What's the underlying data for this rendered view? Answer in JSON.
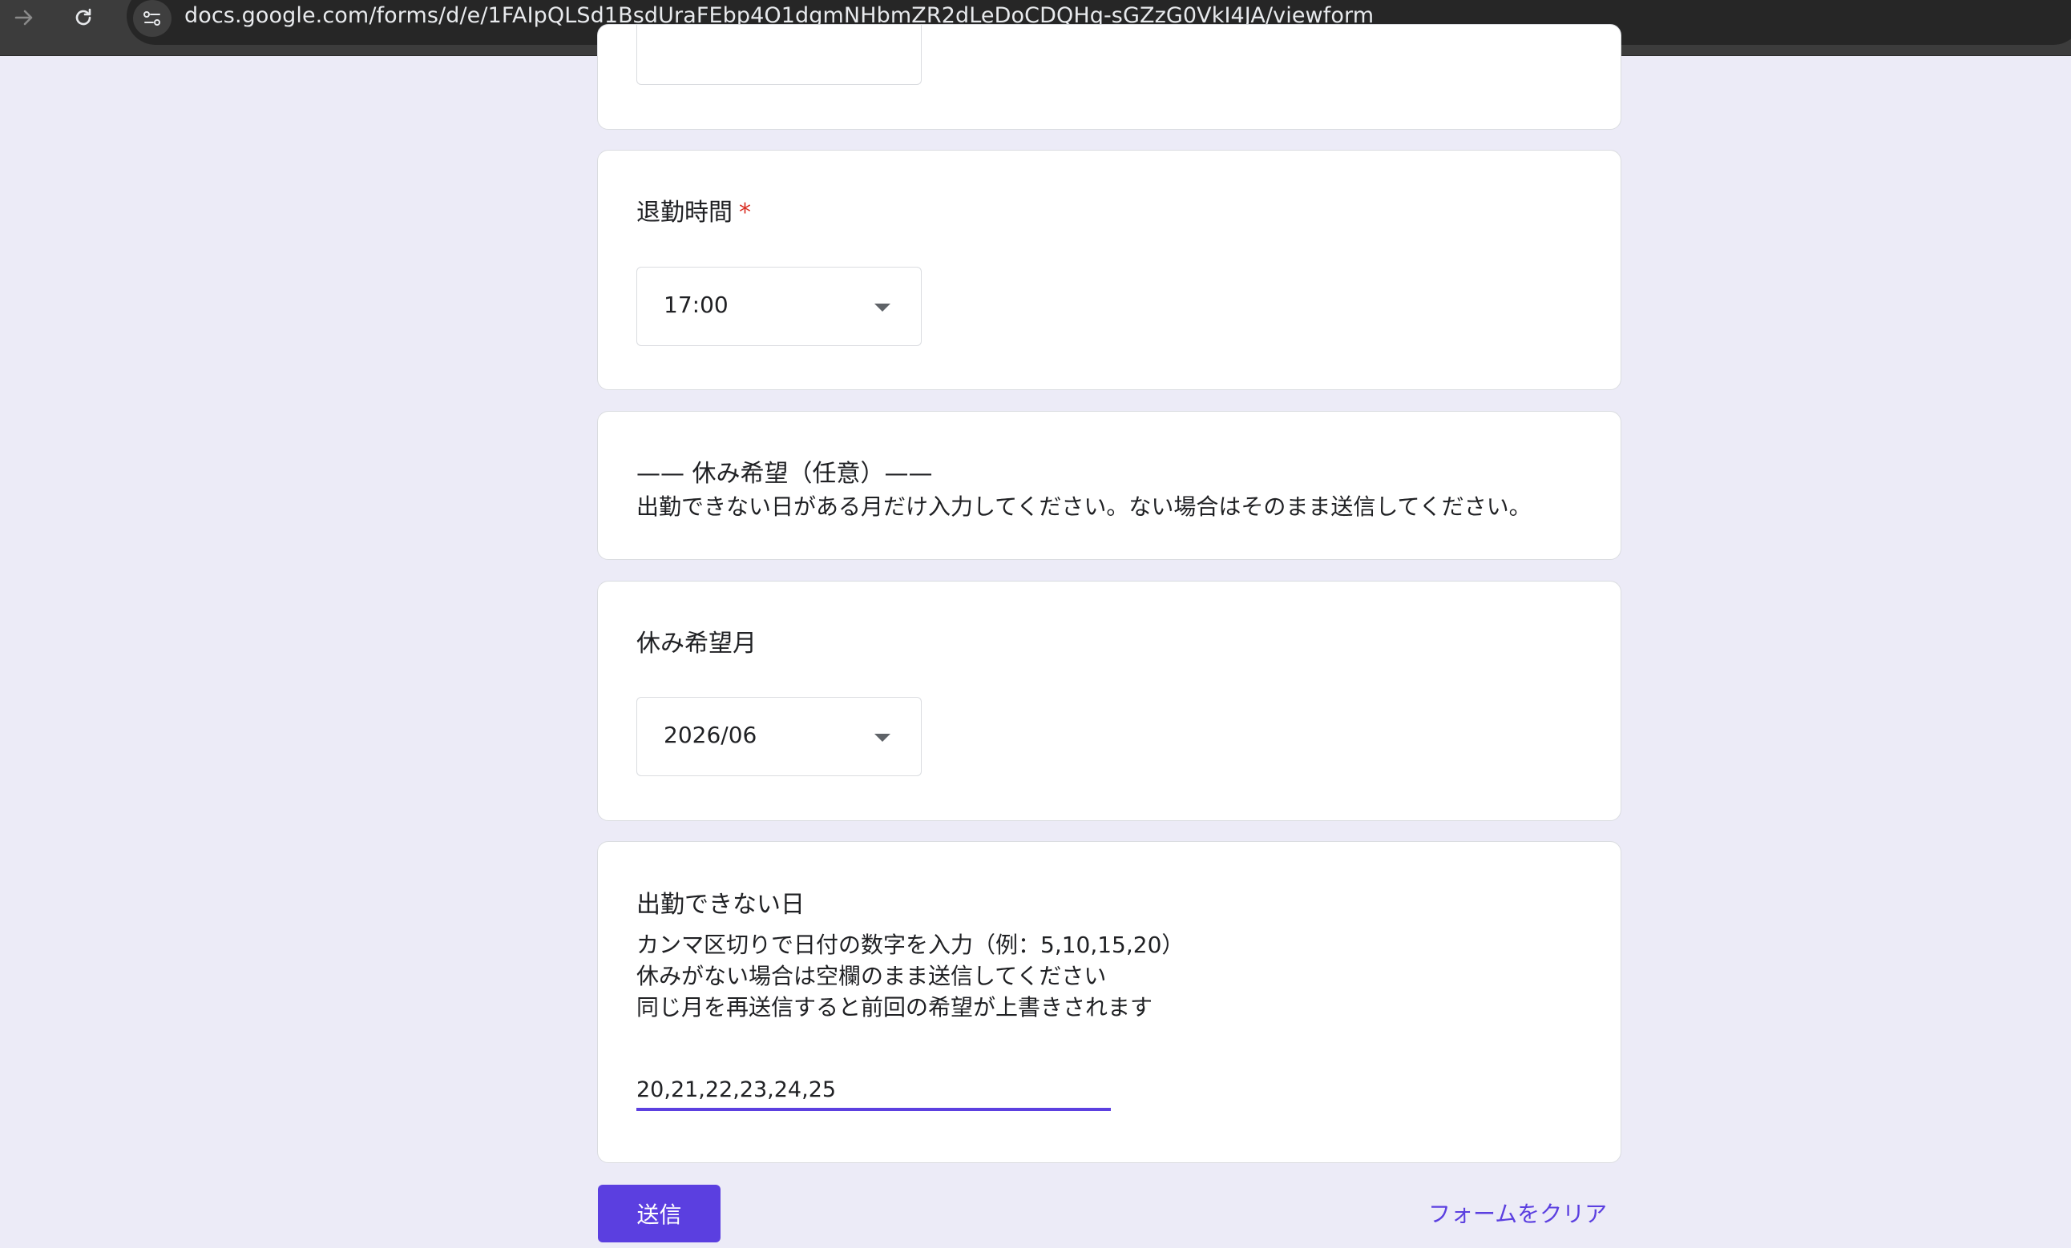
{
  "browser": {
    "url": "docs.google.com/forms/d/e/1FAIpQLSd1BsdUraFEbp4O1dgmNHbmZR2dLeDoCDQHq-sGZzG0VkI4JA/viewform"
  },
  "form": {
    "end_time": {
      "title": "退勤時間",
      "required_mark": "*",
      "value": "17:00"
    },
    "section": {
      "title": "—— 休み希望（任意）——",
      "description": "出勤できない日がある月だけ入力してください。ない場合はそのまま送信してください。"
    },
    "leave_month": {
      "title": "休み希望月",
      "value": "2026/06"
    },
    "unavailable_days": {
      "title": "出勤できない日",
      "description_lines": [
        "カンマ区切りで日付の数字を入力（例：5,10,15,20）",
        "休みがない場合は空欄のまま送信してください",
        "同じ月を再送信すると前回の希望が上書きされます"
      ],
      "value": "20,21,22,23,24,25"
    },
    "submit_label": "送信",
    "clear_label": "フォームをクリア"
  },
  "colors": {
    "accent": "#5b3fe0",
    "background": "#ecebf7",
    "required": "#d93025"
  }
}
